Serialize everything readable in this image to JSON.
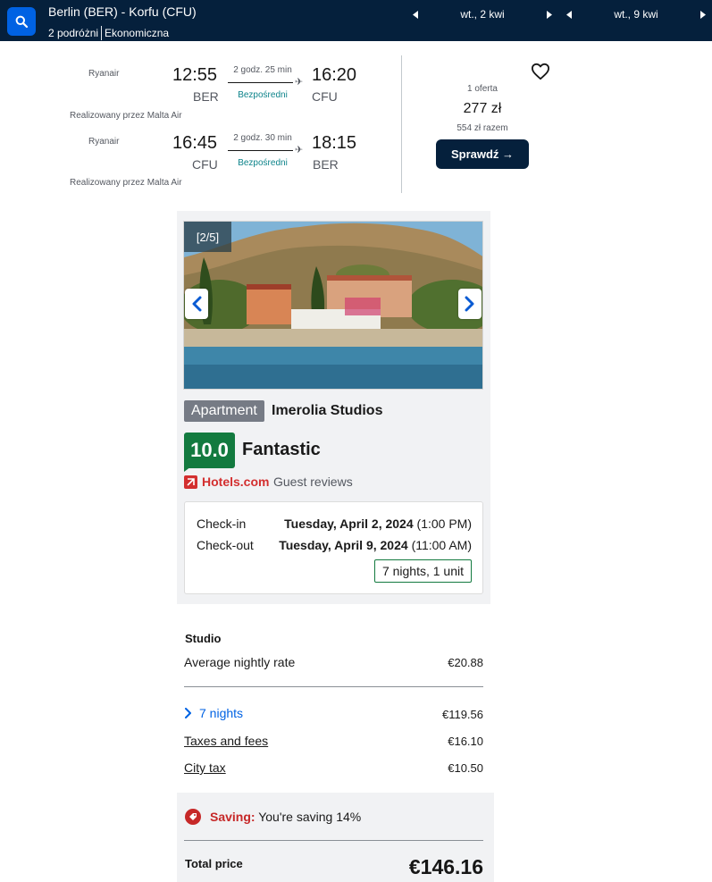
{
  "header": {
    "route": "Berlin (BER) - Korfu (CFU)",
    "travellers": "2 podróżni",
    "cabin": "Ekonomiczna",
    "depart_date": "wt., 2 kwi",
    "return_date": "wt., 9 kwi"
  },
  "flight": {
    "legs": [
      {
        "airline": "Ryanair",
        "depart_time": "12:55",
        "depart_code": "BER",
        "duration": "2 godz. 25 min",
        "stops": "Bezpośredni",
        "arrive_time": "16:20",
        "arrive_code": "CFU",
        "operated_by": "Realizowany przez Malta Air"
      },
      {
        "airline": "Ryanair",
        "depart_time": "16:45",
        "depart_code": "CFU",
        "duration": "2 godz. 30 min",
        "stops": "Bezpośredni",
        "arrive_time": "18:15",
        "arrive_code": "BER",
        "operated_by": "Realizowany przez Malta Air"
      }
    ],
    "offers": "1 oferta",
    "price": "277 zł",
    "total": "554 zł razem",
    "cta": "Sprawdź →"
  },
  "hotel": {
    "photo_counter": "[2/5]",
    "type": "Apartment",
    "name": "Imerolia Studios",
    "score": "10.0",
    "score_label": "Fantastic",
    "review_source": "Hotels.com",
    "review_label": "Guest reviews",
    "checkin_label": "Check-in",
    "checkin_date": "Tuesday, April 2, 2024",
    "checkin_time": "(1:00 PM)",
    "checkout_label": "Check-out",
    "checkout_date": "Tuesday, April 9, 2024",
    "checkout_time": "(11:00 AM)",
    "stay_summary": "7 nights, 1 unit"
  },
  "pricing": {
    "room_type": "Studio",
    "nightly_label": "Average nightly rate",
    "nightly_value": "€20.88",
    "nights_label": "7 nights",
    "nights_value": "€119.56",
    "taxes_label": "Taxes and fees",
    "taxes_value": "€16.10",
    "citytax_label": "City tax",
    "citytax_value": "€10.50",
    "saving_label": "Saving:",
    "saving_text": "You're saving 14%",
    "total_label": "Total price",
    "total_value": "€146.16"
  },
  "colors": {
    "topbar": "#05203c",
    "accent_blue": "#0062e3",
    "score_green": "#137a3f",
    "hotels_red": "#d32f2f",
    "direct_teal": "#0c838a"
  }
}
